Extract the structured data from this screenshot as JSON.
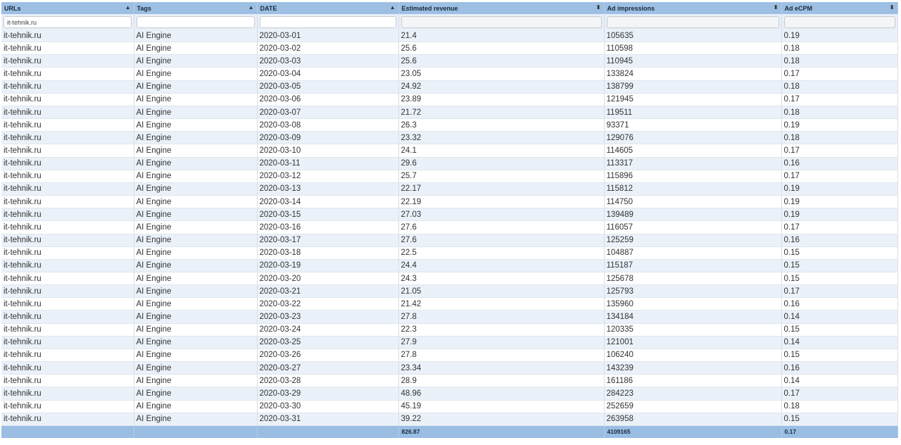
{
  "columns": [
    {
      "label": "URLs",
      "sort": "▲"
    },
    {
      "label": "Tags",
      "sort": "▲"
    },
    {
      "label": "DATE",
      "sort": "▲"
    },
    {
      "label": "Estimated revenue",
      "sort": "⬍"
    },
    {
      "label": "Ad impressions",
      "sort": "⬍"
    },
    {
      "label": "Ad eCPM",
      "sort": "⬍"
    }
  ],
  "filters": {
    "urls": "it-tehnik.ru",
    "tags": "",
    "date": "",
    "revenue": "",
    "impressions": "",
    "ecpm": ""
  },
  "rows": [
    [
      "it-tehnik.ru",
      "AI Engine",
      "2020-03-01",
      "21.4",
      "105635",
      "0.19"
    ],
    [
      "it-tehnik.ru",
      "AI Engine",
      "2020-03-02",
      "25.6",
      "110598",
      "0.18"
    ],
    [
      "it-tehnik.ru",
      "AI Engine",
      "2020-03-03",
      "25.6",
      "110945",
      "0.18"
    ],
    [
      "it-tehnik.ru",
      "AI Engine",
      "2020-03-04",
      "23.05",
      "133824",
      "0.17"
    ],
    [
      "it-tehnik.ru",
      "AI Engine",
      "2020-03-05",
      "24.92",
      "138799",
      "0.18"
    ],
    [
      "it-tehnik.ru",
      "AI Engine",
      "2020-03-06",
      "23.89",
      "121945",
      "0.17"
    ],
    [
      "it-tehnik.ru",
      "AI Engine",
      "2020-03-07",
      "21.72",
      "119511",
      "0.18"
    ],
    [
      "it-tehnik.ru",
      "AI Engine",
      "2020-03-08",
      "26.3",
      "93371",
      "0.19"
    ],
    [
      "it-tehnik.ru",
      "AI Engine",
      "2020-03-09",
      "23.32",
      "129076",
      "0.18"
    ],
    [
      "it-tehnik.ru",
      "AI Engine",
      "2020-03-10",
      "24.1",
      "114605",
      "0.17"
    ],
    [
      "it-tehnik.ru",
      "AI Engine",
      "2020-03-11",
      "29.6",
      "113317",
      "0.16"
    ],
    [
      "it-tehnik.ru",
      "AI Engine",
      "2020-03-12",
      "25.7",
      "115896",
      "0.17"
    ],
    [
      "it-tehnik.ru",
      "AI Engine",
      "2020-03-13",
      "22.17",
      "115812",
      "0.19"
    ],
    [
      "it-tehnik.ru",
      "AI Engine",
      "2020-03-14",
      "22.19",
      "114750",
      "0.19"
    ],
    [
      "it-tehnik.ru",
      "AI Engine",
      "2020-03-15",
      "27.03",
      "139489",
      "0.19"
    ],
    [
      "it-tehnik.ru",
      "AI Engine",
      "2020-03-16",
      "27.6",
      "116057",
      "0.17"
    ],
    [
      "it-tehnik.ru",
      "AI Engine",
      "2020-03-17",
      "27.6",
      "125259",
      "0.16"
    ],
    [
      "it-tehnik.ru",
      "AI Engine",
      "2020-03-18",
      "22.5",
      "104887",
      "0.15"
    ],
    [
      "it-tehnik.ru",
      "AI Engine",
      "2020-03-19",
      "24.4",
      "115187",
      "0.15"
    ],
    [
      "it-tehnik.ru",
      "AI Engine",
      "2020-03-20",
      "24.3",
      "125678",
      "0.15"
    ],
    [
      "it-tehnik.ru",
      "AI Engine",
      "2020-03-21",
      "21.05",
      "125793",
      "0.17"
    ],
    [
      "it-tehnik.ru",
      "AI Engine",
      "2020-03-22",
      "21.42",
      "135960",
      "0.16"
    ],
    [
      "it-tehnik.ru",
      "AI Engine",
      "2020-03-23",
      "27.8",
      "134184",
      "0.14"
    ],
    [
      "it-tehnik.ru",
      "AI Engine",
      "2020-03-24",
      "22.3",
      "120335",
      "0.15"
    ],
    [
      "it-tehnik.ru",
      "AI Engine",
      "2020-03-25",
      "27.9",
      "121001",
      "0.14"
    ],
    [
      "it-tehnik.ru",
      "AI Engine",
      "2020-03-26",
      "27.8",
      "106240",
      "0.15"
    ],
    [
      "it-tehnik.ru",
      "AI Engine",
      "2020-03-27",
      "23.34",
      "143239",
      "0.16"
    ],
    [
      "it-tehnik.ru",
      "AI Engine",
      "2020-03-28",
      "28.9",
      "161186",
      "0.14"
    ],
    [
      "it-tehnik.ru",
      "AI Engine",
      "2020-03-29",
      "48.96",
      "284223",
      "0.17"
    ],
    [
      "it-tehnik.ru",
      "AI Engine",
      "2020-03-30",
      "45.19",
      "252659",
      "0.18"
    ],
    [
      "it-tehnik.ru",
      "AI Engine",
      "2020-03-31",
      "39.22",
      "263958",
      "0.15"
    ]
  ],
  "totals": [
    "",
    "",
    "",
    "826.87",
    "4109165",
    "0.17"
  ]
}
